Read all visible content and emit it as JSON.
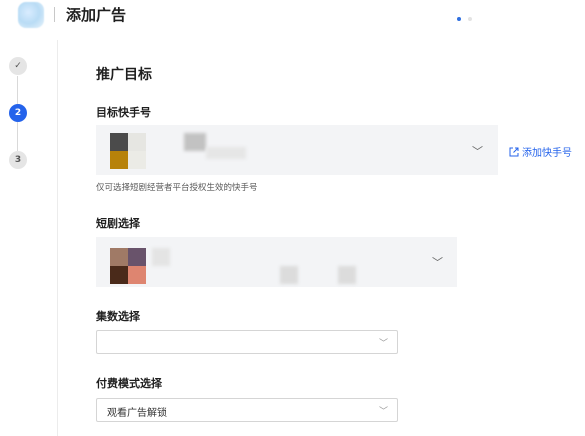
{
  "header": {
    "title": "添加广告",
    "progress_dots": 2,
    "active_dot": 0
  },
  "stepper": {
    "steps": [
      {
        "label": "✓",
        "state": "done"
      },
      {
        "label": "2",
        "state": "active"
      },
      {
        "label": "3",
        "state": "todo"
      }
    ]
  },
  "form": {
    "section_title": "推广目标",
    "account": {
      "label": "目标快手号",
      "add_link": "添加快手号",
      "hint": "仅可选择短剧经营者平台授权生效的快手号"
    },
    "drama": {
      "label": "短剧选择"
    },
    "episodes": {
      "label": "集数选择",
      "value": ""
    },
    "payment": {
      "label": "付费模式选择",
      "value": "观看广告解锁"
    }
  },
  "icons": {
    "chevron": "chevron-down-icon",
    "external_link": "external-link-icon",
    "check": "check-icon"
  },
  "colors": {
    "accent": "#2463eb",
    "field_bg": "#f3f4f6"
  }
}
